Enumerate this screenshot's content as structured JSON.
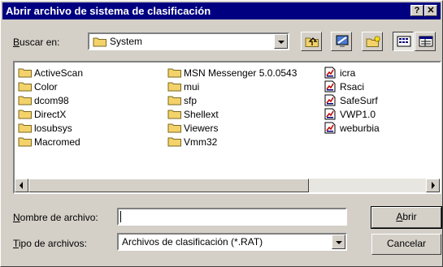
{
  "window": {
    "title": "Abrir archivo de sistema de clasificación",
    "help_label": "?",
    "close_label": "✕"
  },
  "lookin": {
    "label_prefix": "B",
    "label_rest": "uscar en:",
    "value": "System"
  },
  "toolbar": {
    "icons": [
      "up-one-level-icon",
      "desktop-icon",
      "new-folder-icon",
      "list-view-icon",
      "details-view-icon"
    ]
  },
  "files": {
    "col1": [
      {
        "name": "ActiveScan",
        "icon": "folder-icon"
      },
      {
        "name": "Color",
        "icon": "folder-icon"
      },
      {
        "name": "dcom98",
        "icon": "folder-icon"
      },
      {
        "name": "DirectX",
        "icon": "folder-icon"
      },
      {
        "name": "losubsys",
        "icon": "folder-icon"
      },
      {
        "name": "Macromed",
        "icon": "folder-icon"
      }
    ],
    "col2": [
      {
        "name": "MSN Messenger 5.0.0543",
        "icon": "folder-icon"
      },
      {
        "name": "mui",
        "icon": "folder-icon"
      },
      {
        "name": "sfp",
        "icon": "folder-icon"
      },
      {
        "name": "Shellext",
        "icon": "folder-icon"
      },
      {
        "name": "Viewers",
        "icon": "folder-icon"
      },
      {
        "name": "Vmm32",
        "icon": "folder-icon"
      }
    ],
    "col3": [
      {
        "name": "icra",
        "icon": "rat-file-icon"
      },
      {
        "name": "Rsaci",
        "icon": "rat-file-icon"
      },
      {
        "name": "SafeSurf",
        "icon": "rat-file-icon"
      },
      {
        "name": "VWP1.0",
        "icon": "rat-file-icon"
      },
      {
        "name": "weburbia",
        "icon": "rat-file-icon"
      }
    ]
  },
  "filename": {
    "label_prefix": "N",
    "label_rest": "ombre de archivo:",
    "value": ""
  },
  "filetype": {
    "label_prefix": "T",
    "label_rest": "ipo de archivos:",
    "value": "Archivos de clasificación (*.RAT)"
  },
  "buttons": {
    "open_prefix": "A",
    "open_rest": "brir",
    "cancel": "Cancelar"
  },
  "colors": {
    "titlebar": "#000080",
    "face": "#d4d0c8",
    "folder": "#f4d26a"
  }
}
